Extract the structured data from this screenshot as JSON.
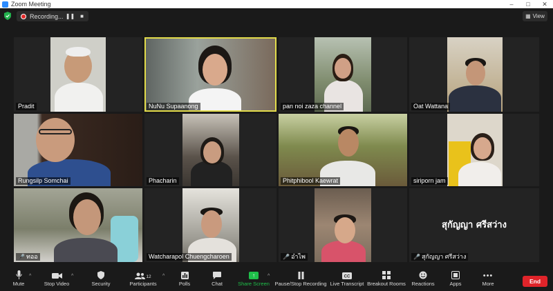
{
  "window": {
    "title": "Zoom Meeting",
    "controls": [
      "–",
      "□",
      "✕"
    ]
  },
  "recording": {
    "label": "Recording...",
    "pause": "❚❚",
    "stop": "■"
  },
  "view": {
    "label": "View"
  },
  "participants": [
    {
      "name": "Pradit",
      "muted": false
    },
    {
      "name": "NuNu Supaanong",
      "muted": false,
      "active": true
    },
    {
      "name": "pan noi zaza channel",
      "muted": false
    },
    {
      "name": "Oat Wattana",
      "muted": false
    },
    {
      "name": "Rungsilp Somchai",
      "muted": false
    },
    {
      "name": "Phacharin",
      "muted": false
    },
    {
      "name": "Phitphibool Kaewrat",
      "muted": false
    },
    {
      "name": "siriporn jam",
      "muted": false
    },
    {
      "name": "ทออ",
      "muted": true
    },
    {
      "name": "Watcharapol Chuengcharoen",
      "muted": false
    },
    {
      "name": "อ๋าไพ",
      "muted": true
    },
    {
      "name": "สุกัญญา ศรีสว่าง",
      "muted": true,
      "video_off": true,
      "display_name": "สุกัญญา ศรีสว่าง"
    }
  ],
  "toolbar": {
    "mute": "Mute",
    "stop_video": "Stop Video",
    "security": "Security",
    "participants": "Participants",
    "participants_count": "12",
    "polls": "Polls",
    "chat": "Chat",
    "share_screen": "Share Screen",
    "pause_recording": "Pause/Stop Recording",
    "live_transcript": "Live Transcript",
    "breakout_rooms": "Breakout Rooms",
    "reactions": "Reactions",
    "apps": "Apps",
    "more": "More",
    "end": "End"
  },
  "colors": {
    "active_speaker": "#e3dc4a",
    "share": "#1fbf4a",
    "end": "#e0242a",
    "record": "#e02828"
  }
}
